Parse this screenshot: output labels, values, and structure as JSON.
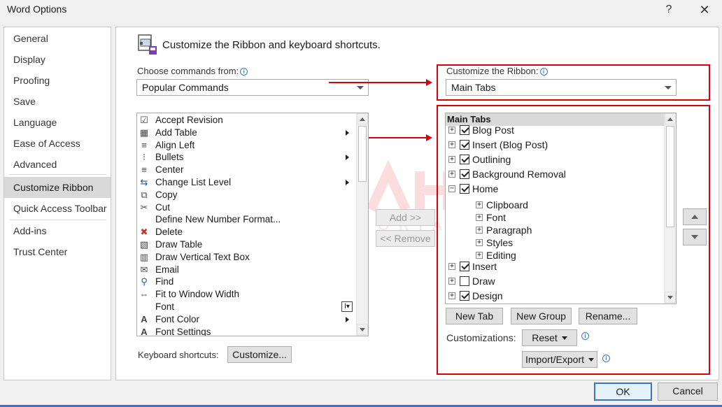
{
  "window": {
    "title": "Word Options",
    "help_label": "?",
    "close_label": "✕"
  },
  "nav": {
    "items": [
      {
        "label": "General"
      },
      {
        "label": "Display"
      },
      {
        "label": "Proofing"
      },
      {
        "label": "Save"
      },
      {
        "label": "Language"
      },
      {
        "label": "Ease of Access"
      },
      {
        "label": "Advanced"
      },
      {
        "label": "Customize Ribbon",
        "selected": true
      },
      {
        "label": "Quick Access Toolbar"
      },
      {
        "label": "Add-ins"
      },
      {
        "label": "Trust Center"
      }
    ]
  },
  "main": {
    "heading": "Customize the Ribbon and keyboard shortcuts.",
    "choose_label": "Choose commands from:",
    "choose_value": "Popular Commands",
    "customize_label": "Customize the Ribbon:",
    "customize_value": "Main Tabs",
    "commands": [
      {
        "label": "Accept Revision",
        "icon": "accept-revision-icon"
      },
      {
        "label": "Add Table",
        "icon": "table-icon",
        "submenu": true
      },
      {
        "label": "Align Left",
        "icon": "align-left-icon"
      },
      {
        "label": "Bullets",
        "icon": "bullets-icon",
        "submenu": true
      },
      {
        "label": "Center",
        "icon": "center-icon"
      },
      {
        "label": "Change List Level",
        "icon": "list-level-icon",
        "submenu": true
      },
      {
        "label": "Copy",
        "icon": "copy-icon"
      },
      {
        "label": "Cut",
        "icon": "cut-icon"
      },
      {
        "label": "Define New Number Format...",
        "icon": ""
      },
      {
        "label": "Delete",
        "icon": "delete-icon"
      },
      {
        "label": "Draw Table",
        "icon": "draw-table-icon"
      },
      {
        "label": "Draw Vertical Text Box",
        "icon": "vertical-text-box-icon"
      },
      {
        "label": "Email",
        "icon": "email-icon"
      },
      {
        "label": "Find",
        "icon": "find-icon"
      },
      {
        "label": "Fit to Window Width",
        "icon": "fit-width-icon"
      },
      {
        "label": "Font",
        "icon": "",
        "submenu_box": true
      },
      {
        "label": "Font Color",
        "icon": "font-color-icon",
        "submenu": true
      },
      {
        "label": "Font Settings",
        "icon": "font-settings-icon"
      }
    ],
    "add_button": "Add >>",
    "remove_button": "<< Remove",
    "tree_header": "Main Tabs",
    "tree": [
      {
        "label": "Blog Post",
        "checked": true,
        "level": 0,
        "expanded": false
      },
      {
        "label": "Insert (Blog Post)",
        "checked": true,
        "level": 0,
        "expanded": false
      },
      {
        "label": "Outlining",
        "checked": true,
        "level": 0,
        "expanded": false
      },
      {
        "label": "Background Removal",
        "checked": true,
        "level": 0,
        "expanded": false
      },
      {
        "label": "Home",
        "checked": true,
        "level": 0,
        "expanded": true
      },
      {
        "label": "Clipboard",
        "level": 1
      },
      {
        "label": "Font",
        "level": 1
      },
      {
        "label": "Paragraph",
        "level": 1
      },
      {
        "label": "Styles",
        "level": 1
      },
      {
        "label": "Editing",
        "level": 1
      },
      {
        "label": "Insert",
        "checked": true,
        "level": 0,
        "expanded": false
      },
      {
        "label": "Draw",
        "checked": false,
        "level": 0,
        "expanded": false
      },
      {
        "label": "Design",
        "checked": true,
        "level": 0,
        "expanded": false
      }
    ],
    "new_tab_button": "New Tab",
    "new_group_button": "New Group",
    "rename_button": "Rename...",
    "customizations_label": "Customizations:",
    "reset_button": "Reset",
    "import_export_button": "Import/Export",
    "keyboard_label": "Keyboard shortcuts:",
    "customize_button": "Customize..."
  },
  "footer": {
    "ok_button": "OK",
    "cancel_button": "Cancel"
  },
  "colors": {
    "highlight_red": "#d9000d",
    "accent_blue": "#3a75c4",
    "selected_nav_bg": "#d9d9d9"
  }
}
